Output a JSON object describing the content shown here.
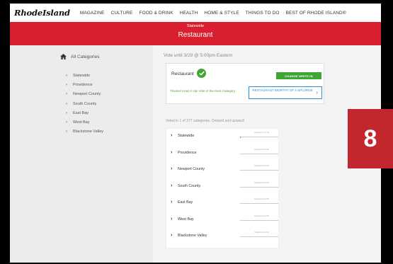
{
  "nav": {
    "logo": "RhodeIsland",
    "items": [
      "MAGAZINE",
      "CULTURE",
      "FOOD & DRINK",
      "HEALTH",
      "HOME & STYLE",
      "THINGS TO DO",
      "BEST OF RHODE ISLAND®"
    ]
  },
  "banner": {
    "subtitle": "Statewide",
    "title": "Restaurant"
  },
  "sidebar": {
    "all_label": "All Categories",
    "items": [
      "Statewide",
      "Providence",
      "Newport County",
      "South County",
      "East Bay",
      "West Bay",
      "Blackstone Valley"
    ]
  },
  "main": {
    "vote_until": "Vote until 3/29 @ 5:00pm Eastern",
    "current_category": "Restaurant",
    "write_in_label": "CHANGE WRITE IN",
    "thanks_text": "Thanks! Keep it Up! Vote in the Next Category",
    "next_label": "RESTAURANT WORTHY OF A SPLURGE",
    "voted_in": "Voted in 1 of 277 categories. Onward and upward!",
    "regions": [
      {
        "name": "Statewide",
        "progress": "Voted in 1 of 73",
        "fraction": 0.02
      },
      {
        "name": "Providence",
        "progress": "Voted in 0 of 34",
        "fraction": 0
      },
      {
        "name": "Newport County",
        "progress": "Voted in 0 of 34",
        "fraction": 0
      },
      {
        "name": "South County",
        "progress": "Voted in 0 of 34",
        "fraction": 0
      },
      {
        "name": "East Bay",
        "progress": "Voted in 0 of 34",
        "fraction": 0
      },
      {
        "name": "West Bay",
        "progress": "Voted in 0 of 34",
        "fraction": 0
      },
      {
        "name": "Blackstone Valley",
        "progress": "Voted in 0 of 34",
        "fraction": 0
      }
    ]
  },
  "badge": {
    "number": "8"
  },
  "colors": {
    "brand_red": "#d91f2f",
    "success_green": "#3fa535",
    "link_blue": "#2b8ed8",
    "badge_red": "#c1272d"
  }
}
